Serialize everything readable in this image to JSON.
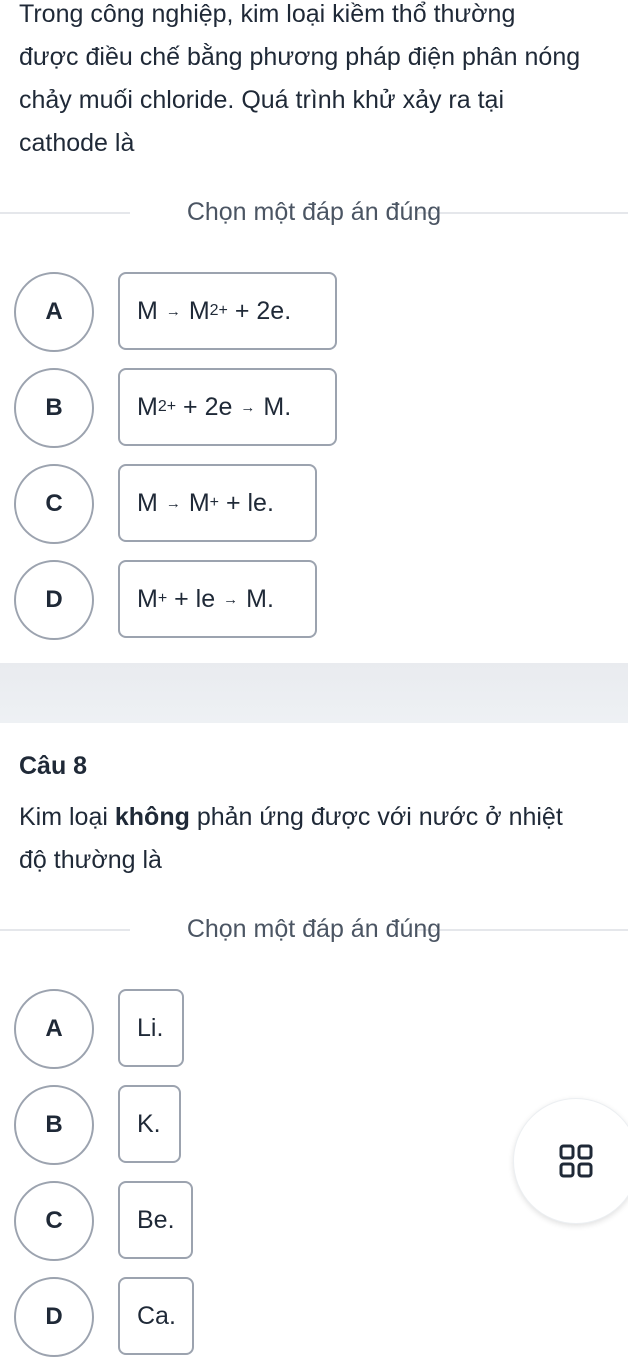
{
  "question7": {
    "text": "Trong công nghiệp, kim loại kiềm thổ thường được điều chế bằng phương pháp điện phân nóng chảy muối chloride. Quá trình khử xảy ra tại cathode là",
    "lines": [
      "Trong công nghiệp, kim loại kiềm thổ thường",
      "được điều chế bằng phương pháp điện phân nóng",
      "chảy muối chloride. Quá trình khử xảy ra tại",
      "cathode là"
    ],
    "prompt": "Chọn một đáp án đúng",
    "options": [
      {
        "letter": "A",
        "parts": [
          "M",
          "→",
          "M",
          "2+",
          " + 2e."
        ]
      },
      {
        "letter": "B",
        "parts": [
          "M",
          "2+",
          " + 2e",
          "→",
          "M."
        ]
      },
      {
        "letter": "C",
        "parts": [
          "M",
          "→",
          "M",
          "+",
          " + le."
        ]
      },
      {
        "letter": "D",
        "parts": [
          "M",
          "+",
          " + le",
          "→",
          "M."
        ]
      }
    ]
  },
  "question8": {
    "title": "Câu 8",
    "line1_before": "Kim loại ",
    "line1_bold": "không",
    "line1_after": " phản ứng được với nước ở nhiệt",
    "line2": "độ thường là",
    "prompt": "Chọn một đáp án đúng",
    "options": [
      {
        "letter": "A",
        "text": "Li."
      },
      {
        "letter": "B",
        "text": "K."
      },
      {
        "letter": "C",
        "text": "Be."
      },
      {
        "letter": "D",
        "text": "Ca."
      }
    ]
  },
  "fab": {
    "icon": "grid-icon"
  }
}
